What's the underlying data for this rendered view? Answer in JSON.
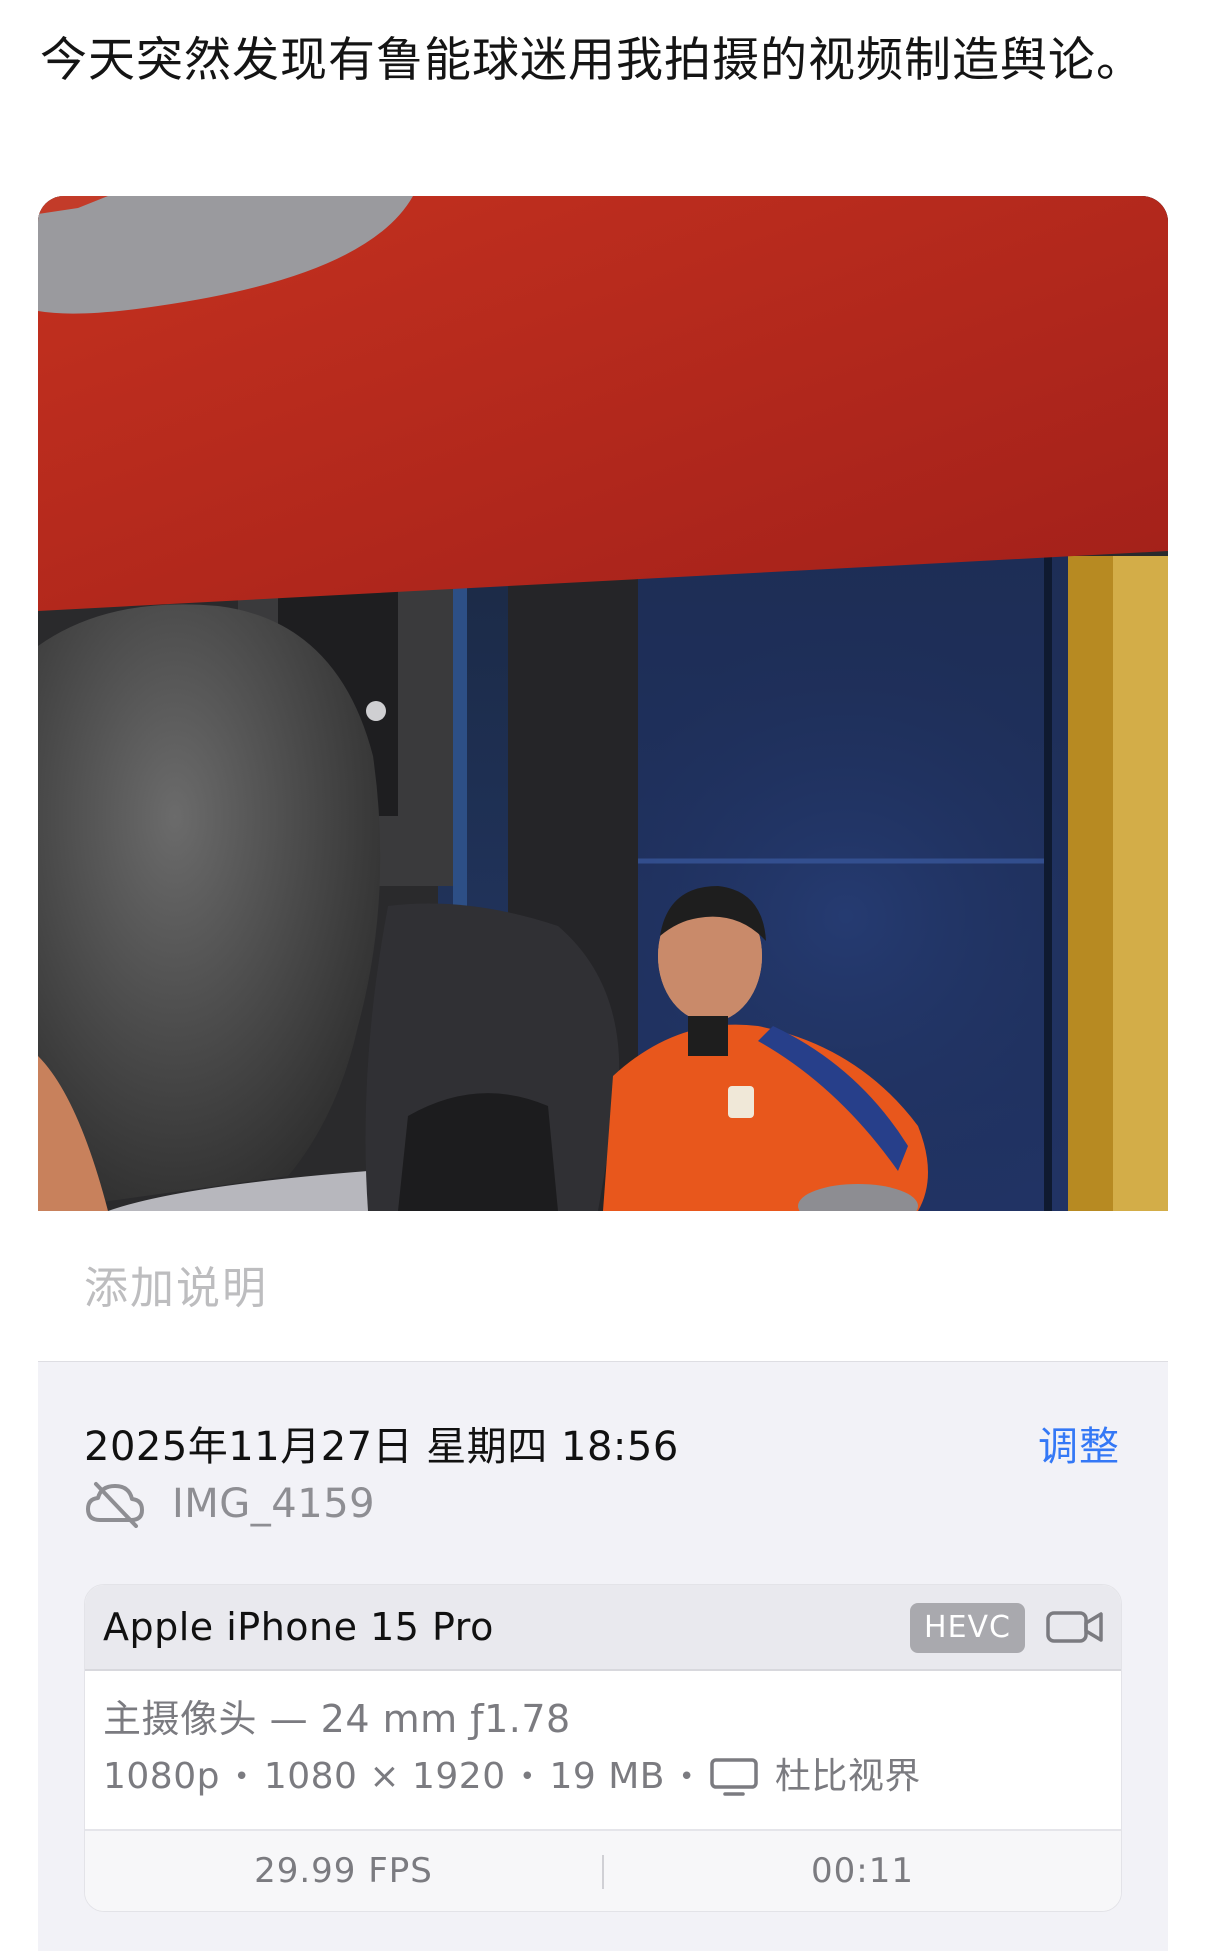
{
  "post": {
    "text": "今天突然发现有鲁能球迷用我拍摄的视频制造舆论。"
  },
  "caption": {
    "placeholder": "添加说明"
  },
  "info": {
    "datetime": "2025年11月27日 星期四 18:56",
    "adjust_label": "调整",
    "filename": "IMG_4159",
    "cloud_icon": "cloud-slash-icon"
  },
  "meta": {
    "device": "Apple iPhone 15 Pro",
    "codec": "HEVC",
    "video_icon": "video-camera-icon",
    "camera": "主摄像头 — 24 mm ƒ1.78",
    "resolution": "1080p",
    "dimensions": "1080 × 1920",
    "size": "19 MB",
    "dot": "•",
    "screen_icon": "display-icon",
    "format": "杜比视界",
    "fps": "29.99 FPS",
    "duration": "00:11"
  },
  "colors": {
    "accent": "#3478f6",
    "panel_bg": "#f2f2f7",
    "secondary_text": "#8e8e93",
    "banner_red": "#b8281d",
    "jersey_orange": "#e8571c"
  }
}
